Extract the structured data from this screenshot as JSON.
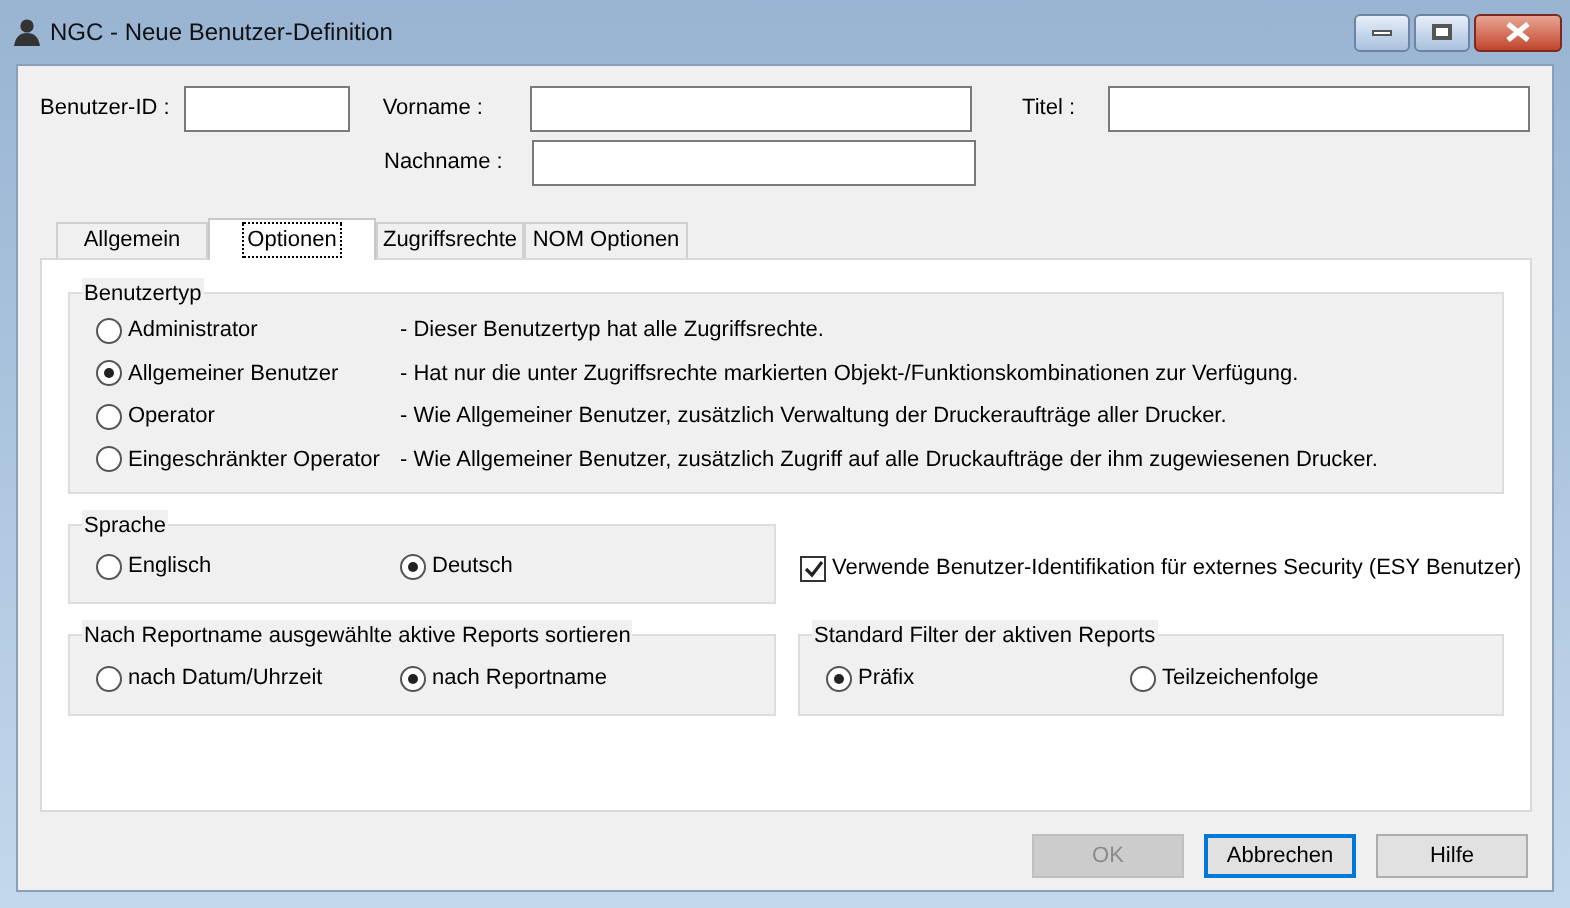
{
  "window": {
    "title": "NGC - Neue Benutzer-Definition"
  },
  "fields": [
    {
      "label": "Benutzer-ID :"
    },
    {
      "label": "Vorname :"
    },
    {
      "label": "Titel :"
    },
    {
      "label": "Nachname :"
    }
  ],
  "tabs": [
    {
      "label": "Allgemein",
      "selected": false
    },
    {
      "label": "Optionen",
      "selected": true
    },
    {
      "label": "Zugriffsrechte",
      "selected": false
    },
    {
      "label": "NOM Optionen",
      "selected": false
    }
  ],
  "benutzertyp": {
    "title": "Benutzertyp",
    "options": [
      {
        "label": "Administrator",
        "description": "- Dieser Benutzertyp hat alle Zugriffsrechte.",
        "selected": false
      },
      {
        "label": "Allgemeiner Benutzer",
        "description": "- Hat nur die unter Zugriffsrechte markierten Objekt-/Funktionskombinationen zur Verfügung.",
        "selected": true
      },
      {
        "label": "Operator",
        "description": "- Wie Allgemeiner Benutzer, zusätzlich Verwaltung der Druckeraufträge aller Drucker.",
        "selected": false
      },
      {
        "label": "Eingeschränkter Operator",
        "description": "- Wie Allgemeiner Benutzer, zusätzlich Zugriff auf alle Druckaufträge der ihm zugewiesenen Drucker.",
        "selected": false
      }
    ]
  },
  "sprache": {
    "title": "Sprache",
    "options": [
      {
        "label": "Englisch",
        "selected": false
      },
      {
        "label": "Deutsch",
        "selected": true
      }
    ]
  },
  "esy_checkbox": {
    "label": "Verwende Benutzer-Identifikation für externes Security (ESY Benutzer)",
    "checked": true
  },
  "sortierung": {
    "title": "Nach Reportname ausgewählte aktive Reports sortieren",
    "options": [
      {
        "label": "nach Datum/Uhrzeit",
        "selected": false
      },
      {
        "label": "nach Reportname",
        "selected": true
      }
    ]
  },
  "filter": {
    "title": "Standard Filter der aktiven Reports",
    "options": [
      {
        "label": "Präfix",
        "selected": true
      },
      {
        "label": "Teilzeichenfolge",
        "selected": false
      }
    ]
  },
  "buttons": [
    {
      "label": "OK",
      "disabled": true,
      "default": false
    },
    {
      "label": "Abbrechen",
      "disabled": false,
      "default": true
    },
    {
      "label": "Hilfe",
      "disabled": false,
      "default": false
    }
  ]
}
